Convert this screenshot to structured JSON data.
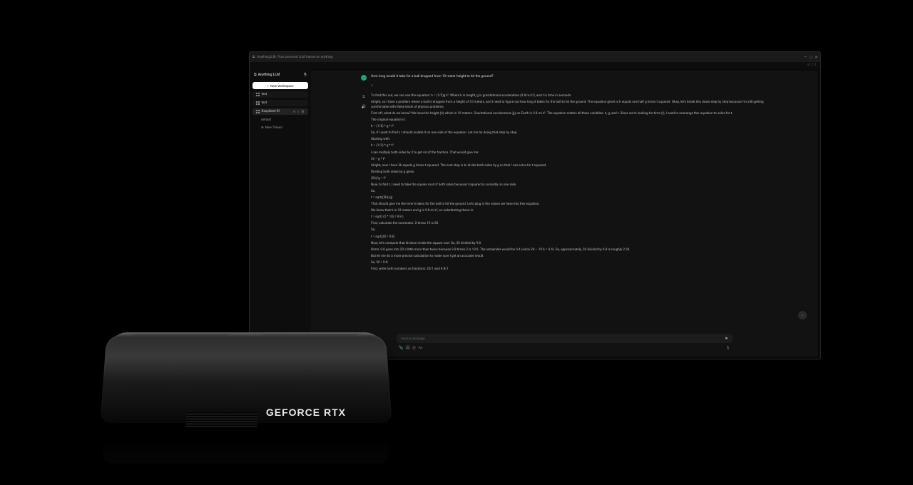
{
  "titlebar": {
    "text": "AnythingLLM | Your personal LLM trained on anything",
    "min": "–",
    "max": "□",
    "close": "×"
  },
  "version": "v1.7.5",
  "sidebar": {
    "brand": "Anything LLM",
    "collapse_icon": "⎘",
    "new_workspace": "New Workspace",
    "items": [
      {
        "label": "test"
      },
      {
        "label": "test"
      }
    ],
    "active": {
      "label": "DeepSeek-R1"
    },
    "sub": [
      {
        "label": "default"
      },
      {
        "label": "New Thread"
      }
    ]
  },
  "chat": {
    "user_msg": "How long would it take for a ball dropped from 10 meter height to hit the ground?",
    "bot_lines": [
      "To find this out, we can use the equation: h = (1/2)g·t². Where h is height, g is gravitational acceleration (9.8 m/s²), and t is time in seconds.",
      "Alright, so I have a problem where a ball is dropped from a height of 10 meters, and I need to figure out how long it takes for the ball to hit the ground. The equation given is h equals one half g times t squared. Okay, let's break this down step by step because I'm still getting comfortable with these kinds of physics problems.",
      "First off, what do we know? We have the height (h) which is 10 meters. Gravitational acceleration (g) on Earth is 9.8 m/s². The equation relates all three variables: h, g, and t. Since we're looking for time (t), I need to rearrange this equation to solve for t.",
      "The original equation is:",
      "h = (1/2) * g * t²",
      "So, if I want to find t, I should isolate it on one side of the equation. Let me try doing that step by step.",
      "Starting with:",
      "h = (1/2) * g * t²",
      "I can multiply both sides by 2 to get rid of the fraction. That would give me:",
      "2h = g * t²",
      "Alright, now I have 2h equals g times t squared. The next step is to divide both sides by g so that I can solve for t squared.",
      "Dividing both sides by g gives:",
      "(2h)/g = t²",
      "Now, to find t, I need to take the square root of both sides because t squared is currently on one side.",
      "So,",
      "t = sqrt((2h)/g)",
      "That should give me the time it takes for the ball to hit the ground. Let's plug in the values we have into this equation.",
      "We know that h is 10 meters and g is 9.8 m/s², so substituting these in:",
      "t = sqrt( (2 * 10) / 9.8 )",
      "First, calculate the numerator: 2 times 10 is 20.",
      "So,",
      "t = sqrt(20 / 9.8)",
      "Now, let's compute that division inside the square root. So, 20 divided by 9.8.",
      "Hmm, 9.8 goes into 20 a little more than twice because 9.8 times 2 is 19.6. The remainder would be 0.4 (since 20 – 19.6 = 0.4). So, approximately, 20 divided by 9.8 is roughly 2.04.",
      "But let me do a more precise calculation to make sure I get an accurate result.",
      "So, 20 / 9.8:",
      "First, write both numbers as fractions: 20/1 and 9.8/1."
    ],
    "input_placeholder": "Send a message",
    "send_icon": "➤",
    "mic_icon": "🎤"
  },
  "gpu": {
    "label": "GEFORCE RTX"
  }
}
